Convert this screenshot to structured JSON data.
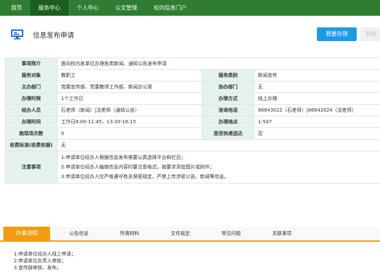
{
  "nav": {
    "items": [
      "首页",
      "服务中心",
      "个人中心",
      "公文管理",
      "校内信息门户"
    ],
    "active": "服务中心"
  },
  "header": {
    "title": "信息发布申请",
    "apply_button": "我要办理",
    "second_button": "我要"
  },
  "info": {
    "summary_label": "事项简介",
    "summary_value": "面向校内各单位办理各类新闻、通知公告发布申请",
    "target_label": "服务对象",
    "target_value": "教职工",
    "category_label": "服务类别",
    "category_value": "新闻宣传",
    "dept_label": "主办部门",
    "dept_value": "党委宣传部、党委教师工作部、新闻办公室",
    "co_dept_label": "协办部门",
    "co_dept_value": "无",
    "deadline_label": "办理时限",
    "deadline_value": "1个工作日",
    "method_label": "办理方式",
    "method_value": "线上办理",
    "handler_label": "经办人员",
    "handler_value": "石老师（新闻）|沈老师（通知公告）",
    "phone_label": "咨询电话",
    "phone_value": "86843022（石老师）|86843024（沈老师）",
    "time_label": "办理时间",
    "time_value": "工作日8:00-11:45，13:30-16:15",
    "place_label": "办理地点",
    "place_value": "1-547",
    "visits_label": "跑现场次数",
    "visits_value": "0",
    "express_label": "是否快递送达",
    "express_value": "否",
    "fee_label": "收费标准(收费依据)",
    "fee_value": "无",
    "notes_label": "注意事项",
    "notes": [
      "1.申请单位经办人根据信息发布需要认真选择平台和栏目；",
      "2.申请单位经办人编辑信息内容时要注意格式，按要求添加图片或附件；",
      "3.申请单位经办人应严格遵守有关保密规定，严禁上传涉密公告、新闻等信息。"
    ]
  },
  "tabs": {
    "process": "办事流程",
    "notice": "公告信息",
    "materials": "所需材料",
    "docs": "文件规定",
    "faq": "常见问题",
    "related": "关联事项"
  },
  "process_steps": [
    "1.申请单位经办人线上申请；",
    "2.申请单位负责人审核；",
    "3.宣传部审核、发布。"
  ],
  "colors": {
    "nav_bg": "#2e7d32",
    "accent_blue": "#1e9be8",
    "label_bg": "#e6f3ec",
    "tab_active": "#f39c12"
  }
}
